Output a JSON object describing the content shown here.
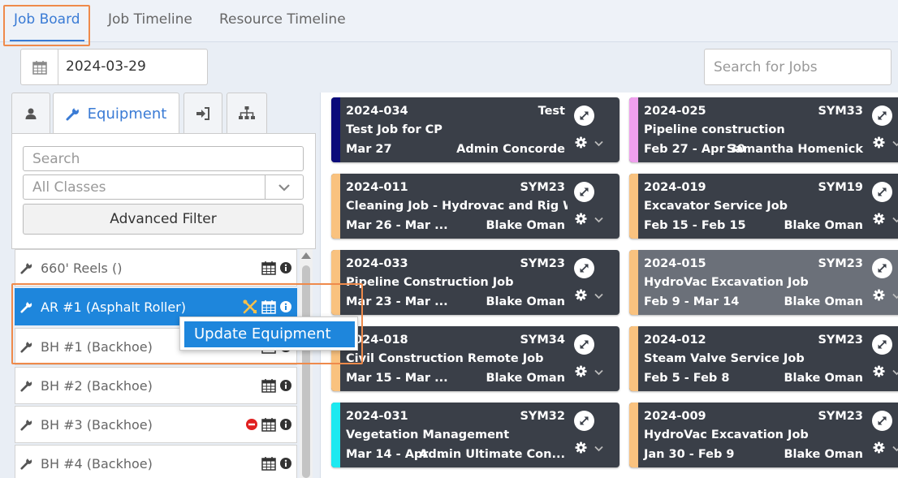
{
  "tabs": [
    {
      "label": "Job Board",
      "active": true
    },
    {
      "label": "Job Timeline",
      "active": false
    },
    {
      "label": "Resource Timeline",
      "active": false
    }
  ],
  "date": {
    "value": "2024-03-29"
  },
  "job_search": {
    "placeholder": "Search for Jobs"
  },
  "panel_tabs": {
    "equipment_label": "Equipment"
  },
  "filters": {
    "search_placeholder": "Search",
    "class_select": "All Classes",
    "advanced_filter": "Advanced Filter"
  },
  "equipment": [
    {
      "name": "660' Reels ()"
    },
    {
      "name": "AR #1 (Asphalt Roller)"
    },
    {
      "name": "BH #1 (Backhoe)"
    },
    {
      "name": "BH #2 (Backhoe)"
    },
    {
      "name": "BH #3 (Backhoe)"
    },
    {
      "name": "BH #4 (Backhoe)"
    }
  ],
  "context_menu": {
    "item": "Update Equipment"
  },
  "jobs": [
    {
      "number": "2024-034",
      "code": "Test",
      "title": "Test Job for CP",
      "dates": "Mar 27",
      "owner": "Admin Concorde",
      "color": "#0b0b7a"
    },
    {
      "number": "2024-025",
      "code": "SYM33",
      "title": "Pipeline construction",
      "dates": "Feb 27 - Apr 30",
      "owner": "Samantha Homenick",
      "color": "#f0a0ee"
    },
    {
      "number": "2024-011",
      "code": "SYM23",
      "title": "Cleaning Job - Hydrovac and Rig Wa...",
      "dates": "Mar 26 - Mar ...",
      "owner": "Blake Oman",
      "color": "#f9c27f"
    },
    {
      "number": "2024-019",
      "code": "SYM19",
      "title": "Excavator Service Job",
      "dates": "Feb 15 - Feb 15",
      "owner": "Blake Oman",
      "color": "#f9c27f"
    },
    {
      "number": "2024-033",
      "code": "SYM23",
      "title": "Pipeline Construction Job",
      "dates": "Mar 23 - Mar ...",
      "owner": "Blake Oman",
      "color": "#f9c27f"
    },
    {
      "number": "2024-015",
      "code": "SYM23",
      "title": "HydroVac Excavation Job",
      "dates": "Feb 9 - Mar 14",
      "owner": "Blake Oman",
      "color": "#f9c27f"
    },
    {
      "number": "2024-018",
      "code": "SYM34",
      "title": "Civil Construction Remote Job",
      "dates": "Mar 15 - Mar ...",
      "owner": "Blake Oman",
      "color": "#f9c27f"
    },
    {
      "number": "2024-012",
      "code": "SYM23",
      "title": "Steam Valve Service Job",
      "dates": "Feb 5 - Feb 8",
      "owner": "Blake Oman",
      "color": "#f9c27f"
    },
    {
      "number": "2024-031",
      "code": "SYM32",
      "title": "Vegetation Management",
      "dates": "Mar 14 - Apr ...",
      "owner": "Admin Ultimate Con...",
      "color": "#1de9f0"
    },
    {
      "number": "2024-009",
      "code": "SYM23",
      "title": "HydroVac Excavation Job",
      "dates": "Jan 30 - Feb 9",
      "owner": "Blake Oman",
      "color": "#f9c27f"
    }
  ],
  "colors": {
    "accent": "#3a7bd5",
    "selected": "#1e86dc",
    "highlight": "#ef8a4b",
    "card": "#3a3f48"
  }
}
